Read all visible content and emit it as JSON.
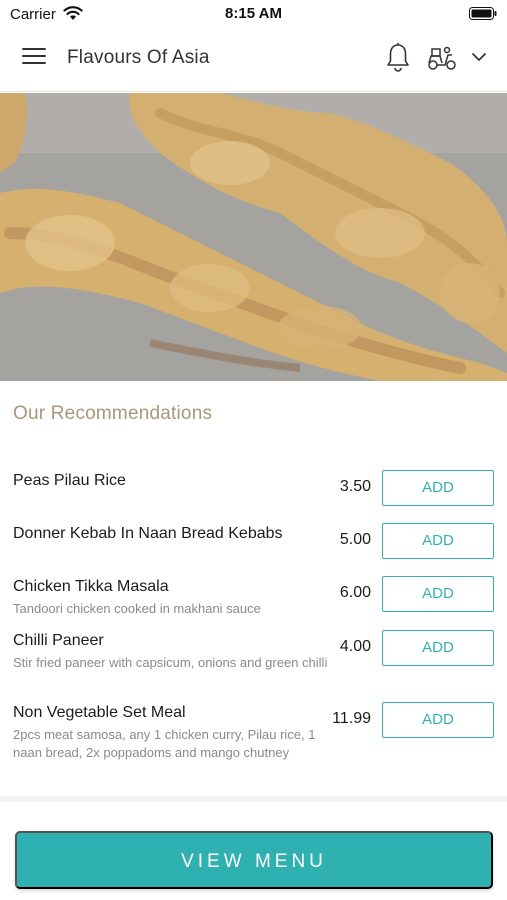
{
  "status_bar": {
    "carrier": "Carrier",
    "time": "8:15 AM"
  },
  "header": {
    "title": "Flavours Of Asia",
    "icons": [
      "menu-icon",
      "bell-icon",
      "scooter-icon",
      "chevron-down-icon"
    ]
  },
  "hero": {
    "image": "chicken-tikka-skewers-photo"
  },
  "recommendations": {
    "title": "Our Recommendations",
    "add_label": "ADD",
    "items": [
      {
        "name": "Peas Pilau Rice",
        "description": "",
        "price": "3.50"
      },
      {
        "name": "Donner Kebab In Naan Bread Kebabs",
        "description": "",
        "price": "5.00"
      },
      {
        "name": "Chicken Tikka Masala",
        "description": "Tandoori chicken cooked in makhani sauce",
        "price": "6.00"
      },
      {
        "name": "Chilli Paneer",
        "description": "Stir fried paneer with capsicum, onions and green chilli",
        "price": "4.00"
      },
      {
        "name": "Non Vegetable Set Meal",
        "description": "2pcs meat samosa, any 1 chicken curry, Pilau rice, 1 naan bread, 2x poppadoms and mango chutney",
        "price": "11.99"
      }
    ]
  },
  "footer": {
    "view_menu_label": "VIEW MENU"
  },
  "colors": {
    "accent": "#30b1b1",
    "section_title": "#a8977a"
  }
}
